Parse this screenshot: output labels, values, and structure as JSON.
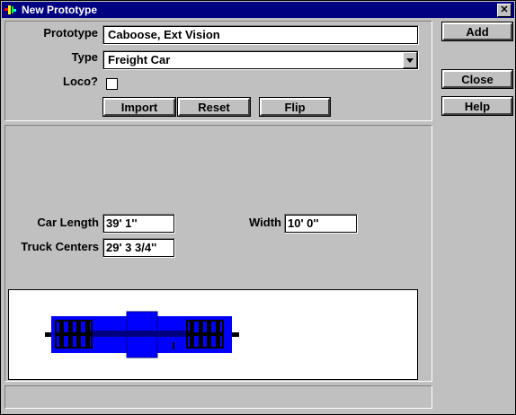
{
  "window": {
    "title": "New Prototype",
    "close_glyph": "✕"
  },
  "form": {
    "prototype_label": "Prototype",
    "prototype_value": "Caboose, Ext Vision",
    "type_label": "Type",
    "type_value": "Freight Car",
    "loco_label": "Loco?",
    "loco_checked": false,
    "import_label": "Import",
    "reset_label": "Reset",
    "flip_label": "Flip"
  },
  "sidebar": {
    "add_label": "Add",
    "close_label": "Close",
    "help_label": "Help"
  },
  "dimensions": {
    "car_length_label": "Car Length",
    "car_length_value": "39' 1''",
    "truck_centers_label": "Truck Centers",
    "truck_centers_value": "29' 3 3/4''",
    "width_label": "Width",
    "width_value": "10' 0''"
  },
  "preview": {
    "car_color": "#0000ff",
    "truck_color": "#000000"
  },
  "status": {
    "text": ""
  }
}
